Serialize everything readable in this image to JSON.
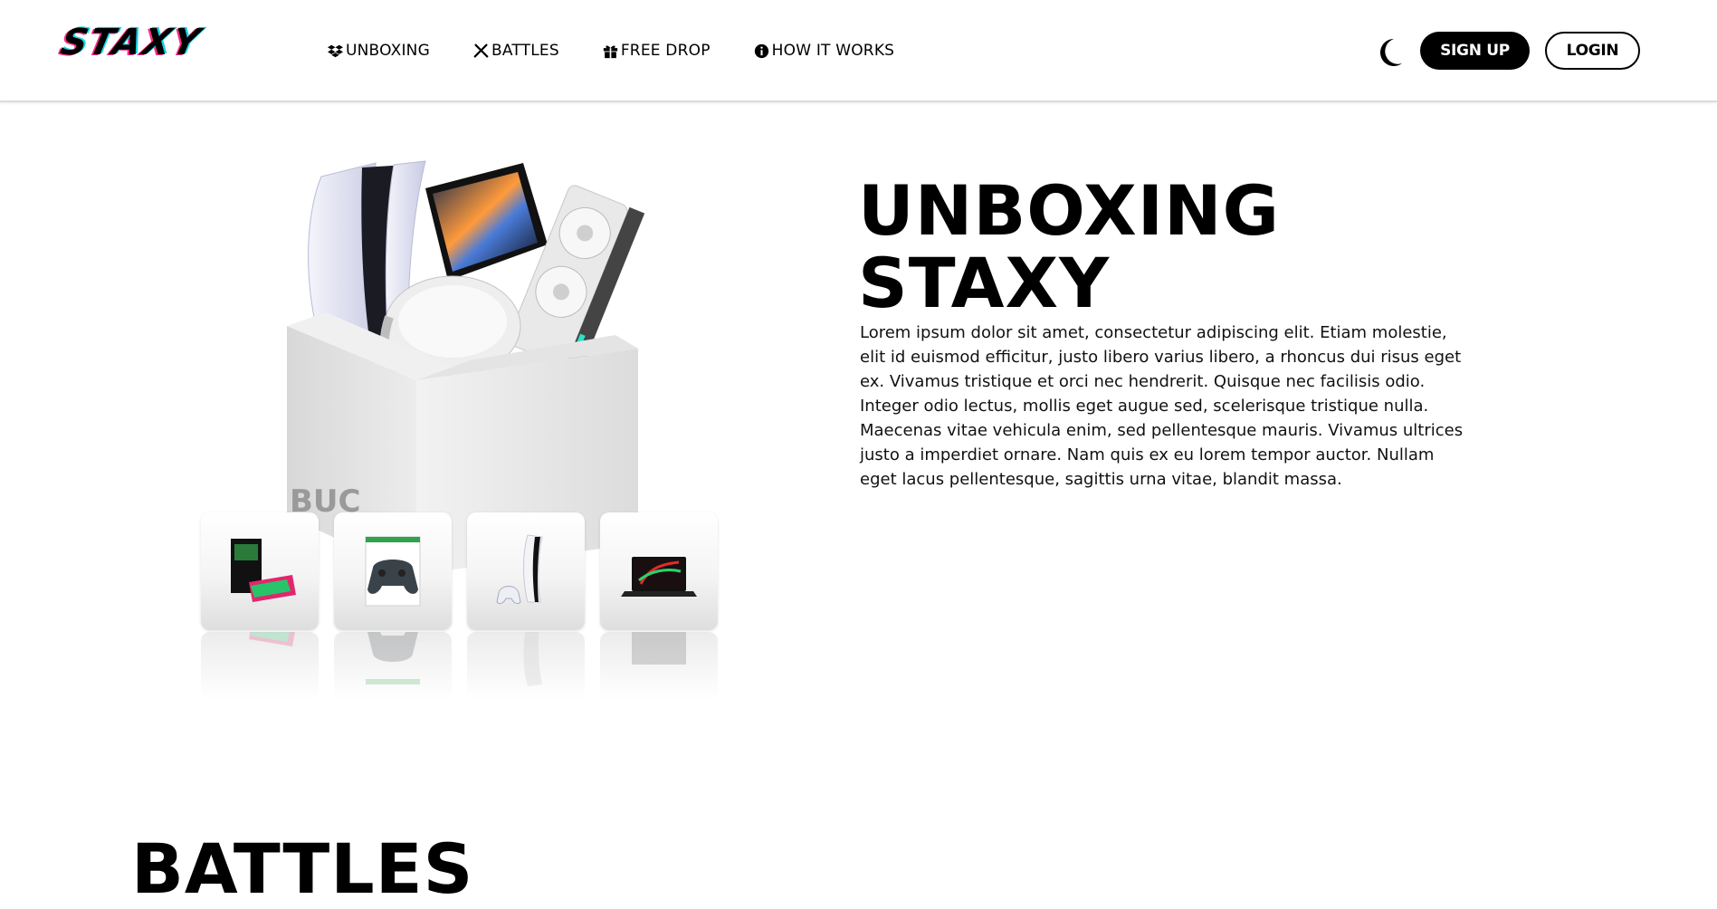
{
  "brand": {
    "logo_text": "STAXY"
  },
  "nav": {
    "items": [
      {
        "label": "UNBOXING",
        "icon": "dropbox-icon"
      },
      {
        "label": "BATTLES",
        "icon": "crossed-swords-icon"
      },
      {
        "label": "FREE DROP",
        "icon": "gift-icon"
      },
      {
        "label": "HOW IT WORKS",
        "icon": "info-circle-icon"
      }
    ]
  },
  "header": {
    "theme_toggle_icon": "moon-icon",
    "signup_label": "SIGN UP",
    "login_label": "LOGIN"
  },
  "hero": {
    "title_line1": "UNBOXING",
    "title_line2": "STAXY",
    "description": "Lorem ipsum dolor sit amet, consectetur adipiscing elit. Etiam molestie, elit id euismod efficitur, justo libero varius libero, a rhoncus dui risus eget ex. Vivamus tristique et orci nec hendrerit. Quisque nec facilisis odio. Integer odio lectus, mollis eget augue sed, scelerisque tristique nulla. Maecenas vitae vehicula enim, sed pellentesque mauris. Vivamus ultrices justo a imperdiet ornare. Nam quis ex eu lorem tempor auctor. Nullam eget lacus pellentesque, sagittis urna vitae, blandit massa.",
    "thumbnails": [
      {
        "name": "graphics-card-box-icon"
      },
      {
        "name": "xbox-controller-icon"
      },
      {
        "name": "ps5-console-icon"
      },
      {
        "name": "gaming-laptop-icon"
      }
    ]
  },
  "next_section": {
    "title": "BATTLES"
  },
  "colors": {
    "primary": "#000000",
    "background": "#ffffff",
    "logo_accent_pink": "#ff2d87",
    "logo_accent_cyan": "#19d3e6"
  }
}
